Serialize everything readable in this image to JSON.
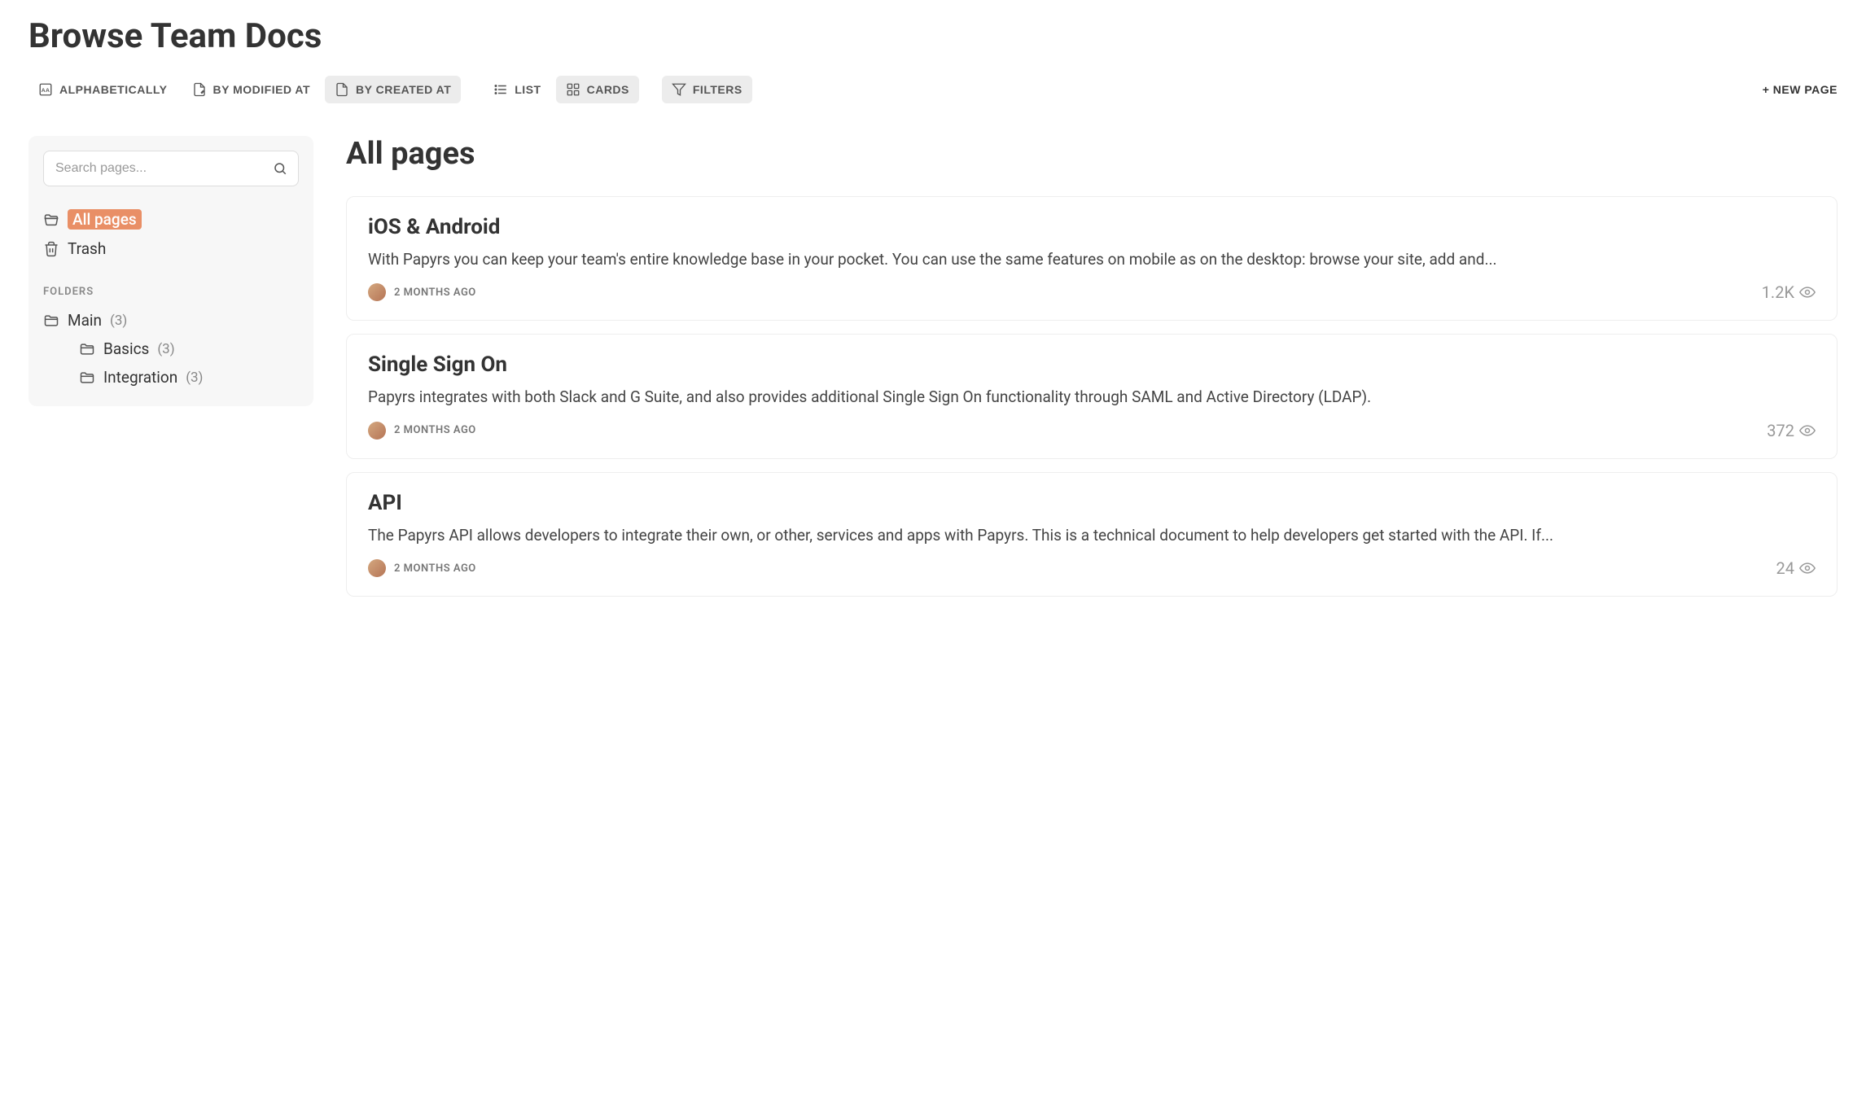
{
  "header": {
    "title": "Browse Team Docs"
  },
  "toolbar": {
    "sort": {
      "alpha": "Alphabetically",
      "modified": "By Modified At",
      "created": "By Created At"
    },
    "view": {
      "list": "List",
      "cards": "Cards"
    },
    "filters": "Filters",
    "new_page": "+ NEW PAGE"
  },
  "sidebar": {
    "search_placeholder": "Search pages...",
    "all_pages": "All pages",
    "trash": "Trash",
    "folders_label": "FOLDERS",
    "folders": [
      {
        "name": "Main",
        "count": "(3)"
      },
      {
        "name": "Basics",
        "count": "(3)"
      },
      {
        "name": "Integration",
        "count": "(3)"
      }
    ]
  },
  "main": {
    "section_title": "All pages",
    "cards": [
      {
        "title": "iOS & Android",
        "desc": "With Papyrs you can keep your team's entire knowledge base in your pocket. You can use the same features on mobile as on the desktop: browse your site, add and...",
        "timestamp": "2 MONTHS AGO",
        "views": "1.2K"
      },
      {
        "title": "Single Sign On",
        "desc": "Papyrs integrates with both Slack and G Suite, and also provides additional Single Sign On functionality through SAML and Active Directory (LDAP).",
        "timestamp": "2 MONTHS AGO",
        "views": "372"
      },
      {
        "title": "API",
        "desc": "The Papyrs API allows developers to integrate their own, or other, services and apps with Papyrs. This is a technical document to help developers get started with the API. If...",
        "timestamp": "2 MONTHS AGO",
        "views": "24"
      }
    ]
  }
}
